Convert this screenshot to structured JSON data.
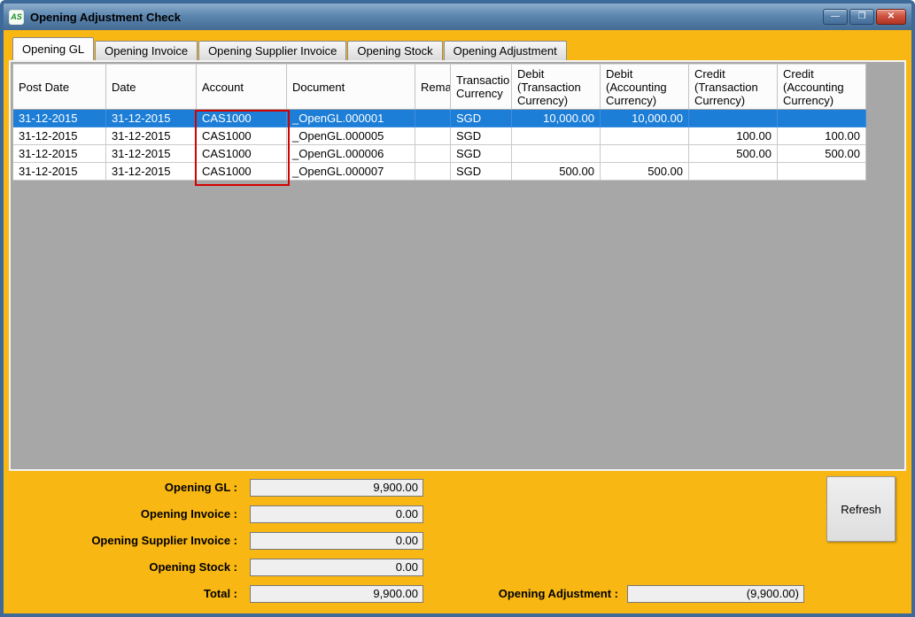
{
  "window": {
    "title": "Opening Adjustment Check",
    "app_icon_text": "AS",
    "controls": {
      "minimize": "—",
      "maximize": "❐",
      "close": "✕"
    }
  },
  "tabs": [
    {
      "label": "Opening GL",
      "active": true
    },
    {
      "label": "Opening Invoice",
      "active": false
    },
    {
      "label": "Opening Supplier Invoice",
      "active": false
    },
    {
      "label": "Opening Stock",
      "active": false
    },
    {
      "label": "Opening Adjustment",
      "active": false
    }
  ],
  "grid": {
    "columns": [
      "Post Date",
      "Date",
      "Account",
      "Document",
      "Rema",
      "Transactio\nCurrency",
      "Debit\n(Transaction\nCurrency)",
      "Debit\n(Accounting\nCurrency)",
      "Credit\n(Transaction\nCurrency)",
      "Credit\n(Accounting\nCurrency)"
    ],
    "selected_row_index": 0,
    "rows": [
      [
        "31-12-2015",
        "31-12-2015",
        "CAS1000",
        "_OpenGL.000001",
        "",
        "SGD",
        "10,000.00",
        "10,000.00",
        "",
        ""
      ],
      [
        "31-12-2015",
        "31-12-2015",
        "CAS1000",
        "_OpenGL.000005",
        "",
        "SGD",
        "",
        "",
        "100.00",
        "100.00"
      ],
      [
        "31-12-2015",
        "31-12-2015",
        "CAS1000",
        "_OpenGL.000006",
        "",
        "SGD",
        "",
        "",
        "500.00",
        "500.00"
      ],
      [
        "31-12-2015",
        "31-12-2015",
        "CAS1000",
        "_OpenGL.000007",
        "",
        "SGD",
        "500.00",
        "500.00",
        "",
        ""
      ]
    ]
  },
  "summary": {
    "fields": [
      {
        "label": "Opening GL :",
        "value": "9,900.00"
      },
      {
        "label": "Opening Invoice :",
        "value": "0.00"
      },
      {
        "label": "Opening Supplier Invoice :",
        "value": "0.00"
      },
      {
        "label": "Opening Stock :",
        "value": "0.00"
      },
      {
        "label": "Total :",
        "value": "9,900.00"
      }
    ],
    "adjustment_label": "Opening Adjustment :",
    "adjustment_value": "(9,900.00)",
    "refresh_label": "Refresh"
  },
  "colors": {
    "accent_yellow": "#F8B713",
    "selected_row": "#1C7ED6",
    "annotation_red": "#D40000",
    "titlebar_blue": "#5D87B0"
  }
}
